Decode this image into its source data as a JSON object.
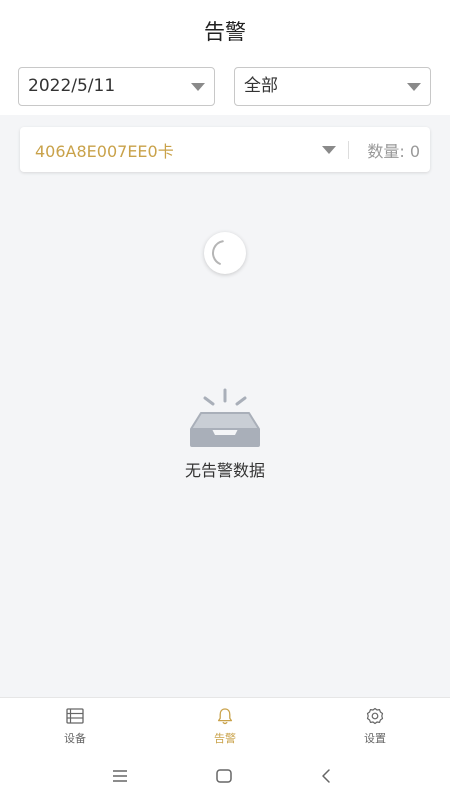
{
  "colors": {
    "accent": "#c9a24a",
    "content_bg": "#f4f5f7"
  },
  "header": {
    "title": "告警"
  },
  "filters": {
    "date": {
      "value": "2022/5/11"
    },
    "category": {
      "value": "全部"
    }
  },
  "device_card": {
    "name": "406A8E007EE0卡",
    "count_label": "数量:",
    "count": 0
  },
  "empty_state": {
    "message": "无告警数据"
  },
  "tabbar": {
    "items": [
      {
        "label": "设备",
        "icon": "list-icon",
        "active": false
      },
      {
        "label": "告警",
        "icon": "bell-icon",
        "active": true
      },
      {
        "label": "设置",
        "icon": "gear-icon",
        "active": false
      }
    ]
  },
  "system_nav": {
    "icons": [
      "menu-icon",
      "home-icon",
      "back-icon"
    ]
  }
}
